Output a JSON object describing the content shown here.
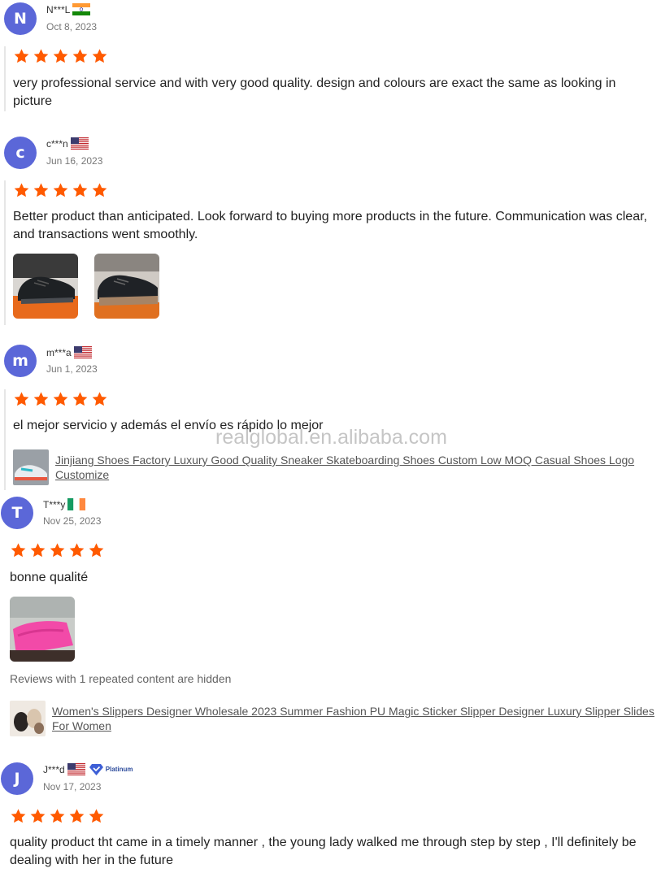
{
  "watermark": "realglobal.en.alibaba.com",
  "colors": {
    "avatar": "#5b67d8",
    "star": "#ff5a00"
  },
  "reviews": [
    {
      "initial": "N",
      "name": "N***L",
      "flag": "india-flag",
      "date": "Oct 8, 2023",
      "rating": 5,
      "text": "very professional service and with very good quality. design and colours are exact the same as looking in picture"
    },
    {
      "initial": "c",
      "name": "c***n",
      "flag": "us-flag",
      "date": "Jun 16, 2023",
      "rating": 5,
      "text": "Better product than anticipated. Look forward to buying more products in the future. Communication was clear, and transactions went smoothly.",
      "images": [
        "black-sneaker-photo",
        "black-sneaker-photo"
      ]
    },
    {
      "initial": "m",
      "name": "m***a",
      "flag": "us-flag",
      "date": "Jun 1, 2023",
      "rating": 5,
      "text": "el mejor servicio y además el envío es rápido lo mejor",
      "product": "Jinjiang Shoes Factory Luxury Good Quality Sneaker Skateboarding Shoes Custom Low MOQ Casual Shoes Logo Customize"
    },
    {
      "initial": "T",
      "name": "T***y",
      "flag": "ireland-flag",
      "date": "Nov 25, 2023",
      "rating": 5,
      "text": "bonne qualité",
      "images": [
        "pink-slipper-photo"
      ],
      "hidden_note": "Reviews with 1 repeated content are hidden",
      "product": "Women's Slippers Designer Wholesale 2023 Summer Fashion PU Magic Sticker Slipper Designer Luxury Slipper Slides For Women"
    },
    {
      "initial": "J",
      "name": "J***d",
      "flag": "us-flag",
      "badge": "Platinum",
      "date": "Nov 17, 2023",
      "rating": 5,
      "text": "quality product tht came in a timely manner , the young lady walked me through step by step , I'll definitely be dealing with her in the future"
    }
  ]
}
